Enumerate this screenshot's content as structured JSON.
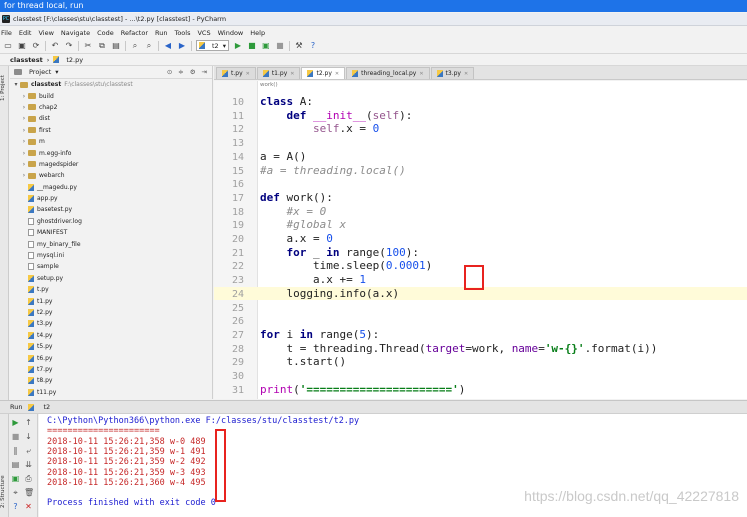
{
  "banner": {
    "text": "for thread local, run"
  },
  "window": {
    "title": "classtest [F:\\classes\\stu\\classtest] - ...\\t2.py [classtest] - PyCharm"
  },
  "menu": [
    "File",
    "Edit",
    "View",
    "Navigate",
    "Code",
    "Refactor",
    "Run",
    "Tools",
    "VCS",
    "Window",
    "Help"
  ],
  "toolbar": {
    "run_config": "t2"
  },
  "breadcrumb": {
    "root": "classtest",
    "file": "t2.py"
  },
  "left_strip": {
    "project": "1: Project",
    "structure": "2: Structure"
  },
  "project_panel": {
    "title": "Project",
    "root_name": "classtest",
    "root_path": "F:\\classes\\stu\\classtest",
    "items": [
      {
        "name": "build",
        "type": "folder"
      },
      {
        "name": "chap2",
        "type": "folder"
      },
      {
        "name": "dist",
        "type": "folder"
      },
      {
        "name": "first",
        "type": "folder"
      },
      {
        "name": "m",
        "type": "folder"
      },
      {
        "name": "m.egg-info",
        "type": "folder"
      },
      {
        "name": "magedspider",
        "type": "folder"
      },
      {
        "name": "webarch",
        "type": "folder"
      },
      {
        "name": "__magedu.py",
        "type": "py"
      },
      {
        "name": "app.py",
        "type": "py"
      },
      {
        "name": "basetest.py",
        "type": "py"
      },
      {
        "name": "ghostdriver.log",
        "type": "txt"
      },
      {
        "name": "MANIFEST",
        "type": "txt"
      },
      {
        "name": "my_binary_file",
        "type": "txt"
      },
      {
        "name": "mysql.ini",
        "type": "txt"
      },
      {
        "name": "sample",
        "type": "txt"
      },
      {
        "name": "setup.py",
        "type": "py"
      },
      {
        "name": "t.py",
        "type": "py"
      },
      {
        "name": "t1.py",
        "type": "py"
      },
      {
        "name": "t2.py",
        "type": "py"
      },
      {
        "name": "t3.py",
        "type": "py"
      },
      {
        "name": "t4.py",
        "type": "py"
      },
      {
        "name": "t5.py",
        "type": "py"
      },
      {
        "name": "t6.py",
        "type": "py"
      },
      {
        "name": "t7.py",
        "type": "py"
      },
      {
        "name": "t8.py",
        "type": "py"
      },
      {
        "name": "t11.py",
        "type": "py"
      }
    ]
  },
  "tabs": [
    {
      "label": "t.py",
      "active": false
    },
    {
      "label": "t1.py",
      "active": false
    },
    {
      "label": "t2.py",
      "active": true
    },
    {
      "label": "threading_local.py",
      "active": false
    },
    {
      "label": "t3.py",
      "active": false
    }
  ],
  "editor": {
    "crumb": "work()",
    "current_line": 24,
    "lines": [
      {
        "n": "10",
        "html": "<span class=\"kw\">class</span> A:"
      },
      {
        "n": "11",
        "html": "    <span class=\"kw\">def</span> <span class=\"fn\">__init__</span>(<span class=\"self\">self</span>):"
      },
      {
        "n": "12",
        "html": "        <span class=\"self\">self</span>.x = <span class=\"num\">0</span>"
      },
      {
        "n": "13",
        "html": ""
      },
      {
        "n": "14",
        "html": "a = A()"
      },
      {
        "n": "15",
        "html": "<span class=\"cmt\">#a = threading.local()</span>"
      },
      {
        "n": "16",
        "html": ""
      },
      {
        "n": "17",
        "html": "<span class=\"kw\">def</span> work():"
      },
      {
        "n": "18",
        "html": "    <span class=\"cmt\">#x = 0</span>"
      },
      {
        "n": "19",
        "html": "    <span class=\"cmt\">#global x</span>"
      },
      {
        "n": "20",
        "html": "    a.x = <span class=\"num\">0</span>"
      },
      {
        "n": "21",
        "html": "    <span class=\"kw\">for</span> _ <span class=\"kw\">in</span> range(<span class=\"num\">100</span>):"
      },
      {
        "n": "22",
        "html": "        time.sleep(<span class=\"num\">0.0001</span>)"
      },
      {
        "n": "23",
        "html": "        a.x += <span class=\"num\">1</span>"
      },
      {
        "n": "24",
        "html": "    logging.info(a.x)"
      },
      {
        "n": "25",
        "html": ""
      },
      {
        "n": "26",
        "html": ""
      },
      {
        "n": "27",
        "html": "<span class=\"kw\">for</span> i <span class=\"kw\">in</span> range(<span class=\"num\">5</span>):"
      },
      {
        "n": "28",
        "html": "    t = threading.Thread(<span class=\"param\">target</span>=work, <span class=\"param\">name</span>=<span class=\"str\">'w-{}'</span>.format(i))"
      },
      {
        "n": "29",
        "html": "    t.start()"
      },
      {
        "n": "30",
        "html": ""
      },
      {
        "n": "31",
        "html": "<span class=\"fn\">print</span>(<span class=\"str\">'======================'</span>)"
      }
    ]
  },
  "run_panel": {
    "label": "Run",
    "config": "t2",
    "lines": [
      {
        "text": "C:\\Python\\Python366\\python.exe F:/classes/stu/classtest/t2.py",
        "kind": "cmd"
      },
      {
        "text": "======================",
        "kind": "err"
      },
      {
        "text": "2018-10-11 15:26:21,358 w-0 489",
        "kind": "err"
      },
      {
        "text": "2018-10-11 15:26:21,359 w-1 491",
        "kind": "err"
      },
      {
        "text": "2018-10-11 15:26:21,359 w-2 492",
        "kind": "err"
      },
      {
        "text": "2018-10-11 15:26:21,359 w-3 493",
        "kind": "err"
      },
      {
        "text": "2018-10-11 15:26:21,360 w-4 495",
        "kind": "err"
      },
      {
        "text": "",
        "kind": "err"
      },
      {
        "text": "Process finished with exit code 0",
        "kind": "ok"
      }
    ]
  },
  "watermark": "https://blog.csdn.net/qq_42227818",
  "colors": {
    "banner": "#1e73e8",
    "highlight_box": "#e8231f",
    "keyword": "#00007f",
    "output": "#c62828"
  }
}
